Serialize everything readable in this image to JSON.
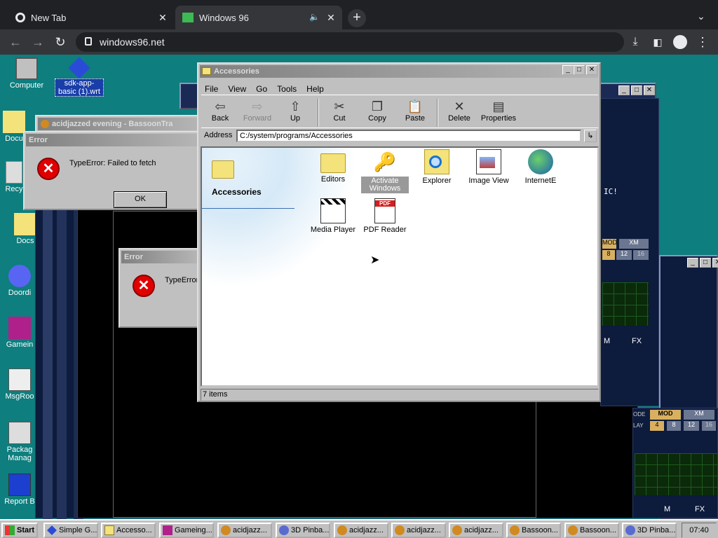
{
  "browser": {
    "tabs": [
      {
        "label": "New Tab"
      },
      {
        "label": "Windows 96"
      }
    ],
    "url": "windows96.net"
  },
  "desktop": {
    "icons": [
      {
        "label": "Computer"
      },
      {
        "label": "sdk-app-basic (1).wrt"
      },
      {
        "label": "Docu"
      },
      {
        "label": "Recy"
      },
      {
        "label": "Docs"
      },
      {
        "label": "Doordi"
      },
      {
        "label": "Gamein"
      },
      {
        "label": "MsgRoo"
      },
      {
        "label": "Packag Manag"
      },
      {
        "label": "Report B"
      }
    ]
  },
  "bassoon_window": {
    "title": "acidjazzed evening - BassoonTra"
  },
  "error1": {
    "title": "Error",
    "message": "TypeError: Failed to fetch",
    "ok": "OK"
  },
  "error2": {
    "title": "Error",
    "message": "TypeError"
  },
  "tracker": {
    "mod": "MOD",
    "xm": "XM",
    "n4": "4",
    "n8": "8",
    "n12": "12",
    "n16": "16",
    "m": "M",
    "fx": "FX",
    "n8b": "8",
    "n12b": "12",
    "n16b": "16",
    "ode": "ODE",
    "lay": "LAY",
    "ic": "IC!",
    "xmb": "XM",
    "mb": "M",
    "fxb": "FX"
  },
  "explorer": {
    "title": "Accessories",
    "menu": [
      "File",
      "View",
      "Go",
      "Tools",
      "Help"
    ],
    "toolbar": [
      "Back",
      "Forward",
      "Up",
      "Cut",
      "Copy",
      "Paste",
      "Delete",
      "Properties"
    ],
    "address_label": "Address",
    "address": "C:/system/programs/Accessories",
    "side_title": "Accessories",
    "items": [
      "Editors",
      "Activate Windows",
      "Explorer",
      "Image View",
      "InternetE",
      "Media Player",
      "PDF Reader"
    ],
    "status": "7 items",
    "pdf_badge": "PDF"
  },
  "taskbar": {
    "start": "Start",
    "buttons": [
      "Simple G...",
      "Accesso...",
      "Gameing...",
      "acidjazz...",
      "3D Pinba...",
      "acidjazz...",
      "acidjazz...",
      "acidjazz...",
      "Bassoon...",
      "Bassoon...",
      "3D Pinba..."
    ],
    "clock": "07:40"
  }
}
